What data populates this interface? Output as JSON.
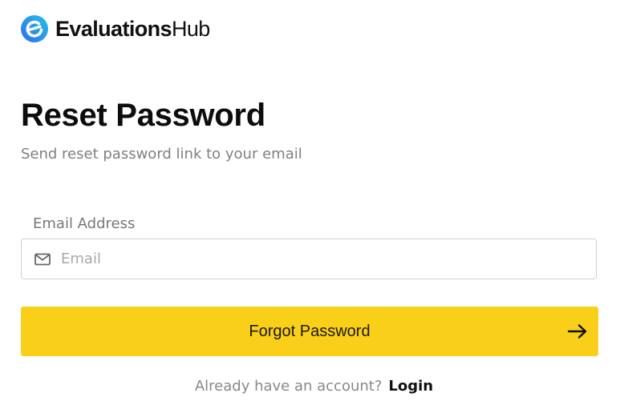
{
  "brand": {
    "name_bold": "Evaluations",
    "name_light": "Hub",
    "logo_icon": "evaluationshub-logo-icon",
    "logo_gradient": [
      "#2f6cf0",
      "#22c1e6"
    ]
  },
  "page": {
    "title": "Reset Password",
    "subtitle": "Send reset password link to your email"
  },
  "form": {
    "email_label": "Email Address",
    "email_value": "",
    "email_placeholder": "Email",
    "email_icon": "mail-icon",
    "submit_label": "Forgot Password",
    "submit_icon": "arrow-right-icon",
    "submit_color": "#f9cf1a"
  },
  "footer": {
    "prompt": "Already have an account?",
    "link_label": "Login"
  }
}
